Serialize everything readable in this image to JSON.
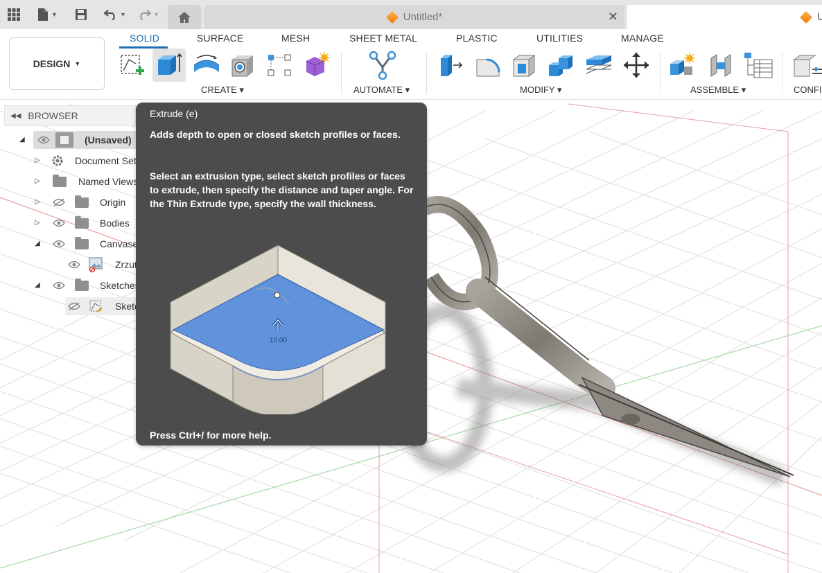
{
  "titlebar": {
    "doc_tab_title": "Untitled*",
    "doc_tab2_title": "U"
  },
  "toolbar": {
    "design_label": "DESIGN",
    "tabs": [
      "SOLID",
      "SURFACE",
      "MESH",
      "SHEET METAL",
      "PLASTIC",
      "UTILITIES",
      "MANAGE"
    ],
    "groups": {
      "create": "CREATE",
      "automate": "AUTOMATE",
      "modify": "MODIFY",
      "assemble": "ASSEMBLE",
      "configure": "CONFI"
    }
  },
  "browser": {
    "title": "BROWSER",
    "items": [
      {
        "label": "(Unsaved)"
      },
      {
        "label": "Document Sett"
      },
      {
        "label": "Named Views"
      },
      {
        "label": "Origin"
      },
      {
        "label": "Bodies"
      },
      {
        "label": "Canvase"
      },
      {
        "label": "Zrzut"
      },
      {
        "label": "Sketches"
      },
      {
        "label": "Sketc"
      }
    ]
  },
  "tooltip": {
    "title": "Extrude (e)",
    "desc1": "Adds depth to open or closed sketch profiles or faces.",
    "desc2": "Select an extrusion type, select sketch profiles or faces to extrude, then specify the distance and taper angle. For the Thin Extrude type, specify the wall thickness.",
    "dim_value": "10.00",
    "help": "Press Ctrl+/ for more help."
  },
  "colors": {
    "accent": "#1f6fb5",
    "tooltip_bg": "#4c4c4c",
    "canvas_grid": "#dcdcdc",
    "axis_red": "#e89a9a",
    "axis_green": "#9fd49f"
  }
}
